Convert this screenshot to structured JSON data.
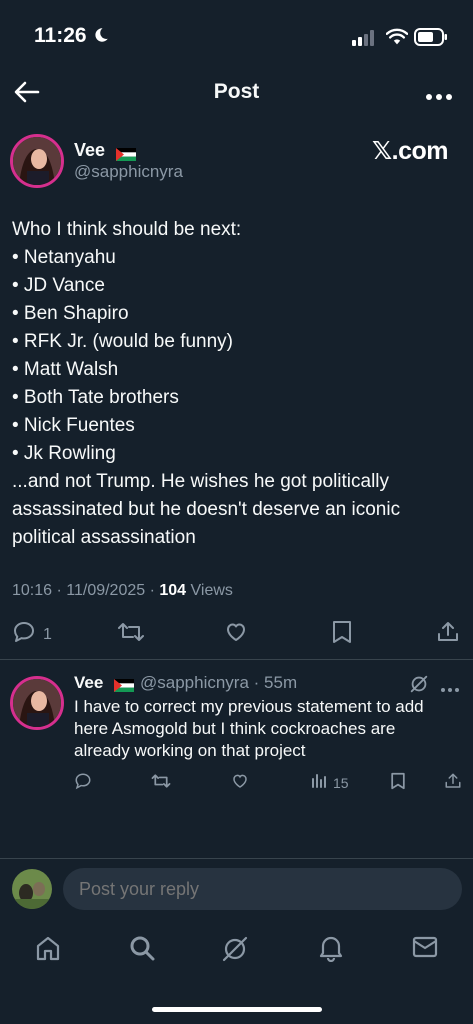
{
  "status": {
    "time": "11:26"
  },
  "header": {
    "title": "Post"
  },
  "post": {
    "author_name": "Vee",
    "author_handle": "@sapphicnyra",
    "brand": "𝕏.com",
    "text_lines": [
      "Who I think should be next:",
      "• Netanyahu",
      "• JD Vance",
      "• Ben Shapiro",
      "• RFK Jr. (would be funny)",
      "• Matt Walsh",
      "• Both Tate brothers",
      "• Nick Fuentes",
      "• Jk Rowling",
      "...and not Trump. He wishes he got politically",
      "assassinated but he doesn't deserve an iconic",
      "political assassination"
    ],
    "timestamp": "10:16 · 11/09/2025 · ",
    "views_count": "104",
    "views_label": " Views",
    "reply_count": "1"
  },
  "reply": {
    "author_name": "Vee",
    "author_handle": "@sapphicnyra · 55m",
    "text_lines": [
      "I have to correct my previous statement to add",
      "here Asmogold but I think cockroaches are",
      "already working on that project"
    ],
    "views_count": "15"
  },
  "composer": {
    "placeholder": "Post your reply"
  },
  "colors": {
    "background": "#15202b",
    "secondary_text": "#8b98a5",
    "divider": "#38444d",
    "avatar_ring": "#d62f8e"
  },
  "icons": {
    "status": [
      "moon-icon",
      "signal-icon",
      "wifi-icon",
      "battery-icon"
    ],
    "header": [
      "back-arrow-icon",
      "more-icon"
    ],
    "actions": [
      "reply-icon",
      "repost-icon",
      "like-icon",
      "bookmark-icon",
      "share-icon",
      "views-icon"
    ],
    "tabs": [
      "home-icon",
      "search-icon",
      "grok-icon",
      "notifications-icon",
      "messages-icon"
    ]
  }
}
